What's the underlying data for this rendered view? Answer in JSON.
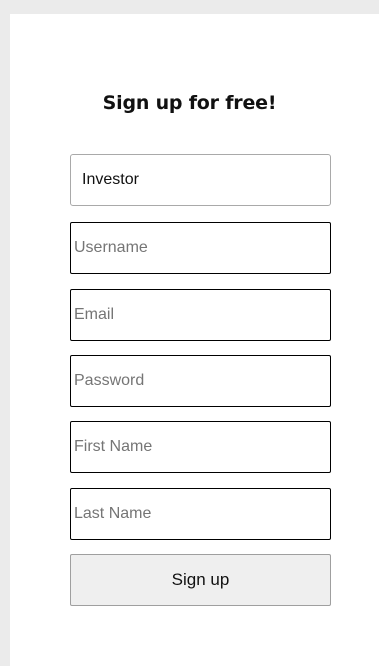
{
  "signup": {
    "title": "Sign up for free!",
    "account_type": "Investor",
    "fields": {
      "username": "Username",
      "email": "Email",
      "password": "Password",
      "first_name": "First Name",
      "last_name": "Last Name"
    },
    "submit_label": "Sign up"
  }
}
